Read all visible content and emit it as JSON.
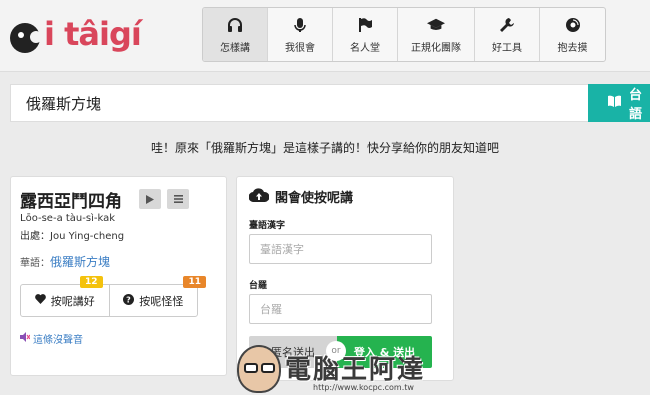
{
  "logo": {
    "text": "i tâigí"
  },
  "nav": [
    {
      "label": "怎樣講",
      "icon": "headphones-icon",
      "active": true
    },
    {
      "label": "我很會",
      "icon": "microphone-icon"
    },
    {
      "label": "名人堂",
      "icon": "flag-icon"
    },
    {
      "label": "正規化團隊",
      "icon": "graduation-cap-icon"
    },
    {
      "label": "好工具",
      "icon": "wrench-icon"
    },
    {
      "label": "抱去摸",
      "icon": "disc-icon"
    }
  ],
  "search": {
    "value": "俄羅斯方塊",
    "button_label": "台語"
  },
  "share_message": "哇！原來「俄羅斯方塊」是這樣子講的！快分享給你的朋友知道吧",
  "word": {
    "title": "露西亞鬥四角",
    "romanization": "Lōo-se-a tàu-sì-kak",
    "source": "出處：Jou Ying-cheng",
    "mandarin_label": "華語：",
    "mandarin_link": "俄羅斯方塊",
    "good_label": "按呢講好",
    "good_count": "12",
    "weird_label": "按呢怪怪",
    "weird_count": "11",
    "no_audio_label": "這條沒聲音"
  },
  "contribute": {
    "title": "閣會使按呢講",
    "hanzi_label": "臺語漢字",
    "hanzi_placeholder": "臺語漢字",
    "romaji_label": "台羅",
    "romaji_placeholder": "台羅",
    "anonymous_button": "匿名送出",
    "or_label": "or",
    "login_button": "登入 & 送出"
  },
  "watermark": {
    "text": "電腦王阿達",
    "url": "http://www.kocpc.com.tw"
  },
  "colors": {
    "brand": "#d9465b",
    "teal": "#19b3a6",
    "green": "#25b34f",
    "badge_yellow": "#f4c20d",
    "badge_orange": "#e8862a"
  }
}
